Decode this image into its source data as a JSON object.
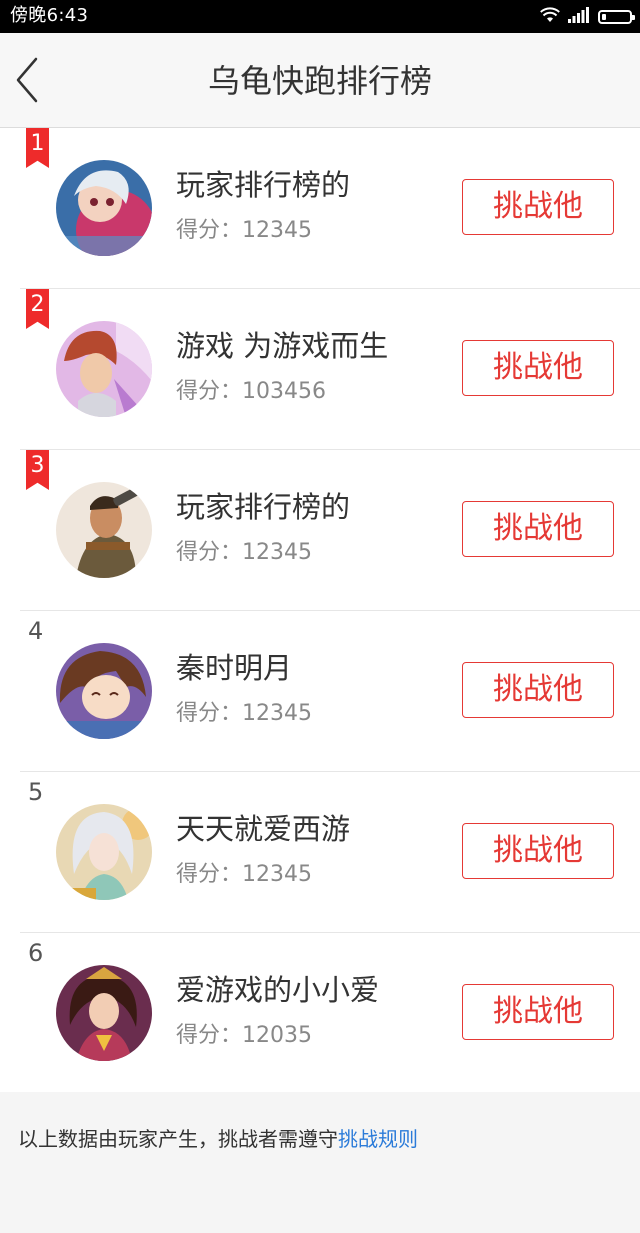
{
  "status_bar": {
    "time": "傍晚6:43",
    "icons": [
      "wifi-icon",
      "signal-icon",
      "battery-icon"
    ]
  },
  "header": {
    "title": "乌龟快跑排行榜",
    "back_icon": "chevron-left-icon"
  },
  "players": [
    {
      "rank": "1",
      "name": "玩家排行榜的",
      "score": "得分：12345",
      "button": "挑战他",
      "top3": true
    },
    {
      "rank": "2",
      "name": "游戏 为游戏而生",
      "score": "得分：103456",
      "button": "挑战他",
      "top3": true
    },
    {
      "rank": "3",
      "name": "玩家排行榜的",
      "score": "得分：12345",
      "button": "挑战他",
      "top3": true
    },
    {
      "rank": "4",
      "name": "秦时明月",
      "score": "得分：12345",
      "button": "挑战他",
      "top3": false
    },
    {
      "rank": "5",
      "name": "天天就爱西游",
      "score": "得分：12345",
      "button": "挑战他",
      "top3": false
    },
    {
      "rank": "6",
      "name": "爱游戏的小小爱",
      "score": "得分：12035",
      "button": "挑战他",
      "top3": false
    }
  ],
  "footer": {
    "note": "以上数据由玩家产生，挑战者需遵守",
    "link": "挑战规则"
  },
  "colors": {
    "accent": "#e53935",
    "ribbon": "#ee2b2b",
    "link": "#2b7bd9"
  }
}
